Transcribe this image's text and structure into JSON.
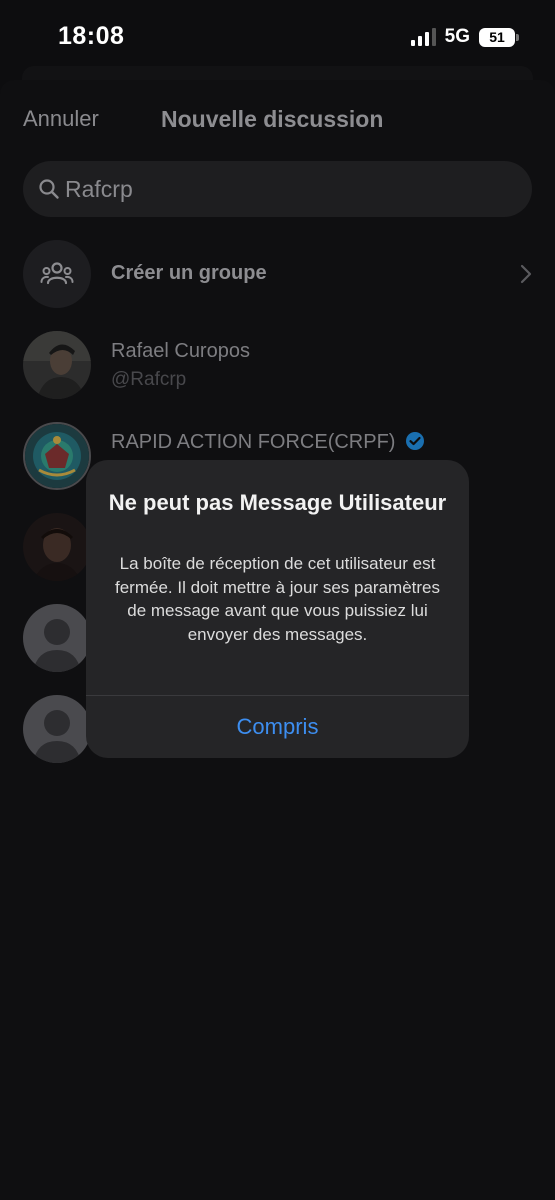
{
  "status_bar": {
    "time": "18:08",
    "network": "5G",
    "battery": "51"
  },
  "header": {
    "cancel_label": "Annuler",
    "title": "Nouvelle discussion"
  },
  "search": {
    "value": "Rafcrp",
    "icon": "search-icon"
  },
  "create_group": {
    "label": "Créer un groupe",
    "icon": "group-icon"
  },
  "results": [
    {
      "name": "Rafael Curopos",
      "handle": "@Rafcrp",
      "verified": false
    },
    {
      "name": "RAPID ACTION FORCE(CRPF)",
      "verified": true
    }
  ],
  "dialog": {
    "title": "Ne peut pas Message Utilisateur",
    "body": "La boîte de réception de cet utilisateur est fermée. Il doit mettre à jour ses paramètres de message avant que vous puissiez lui envoyer des messages.",
    "button_label": "Compris"
  },
  "colors": {
    "accent": "#3d8ef0",
    "verified": "#1d9bf0",
    "dialog_bg": "#252527"
  }
}
